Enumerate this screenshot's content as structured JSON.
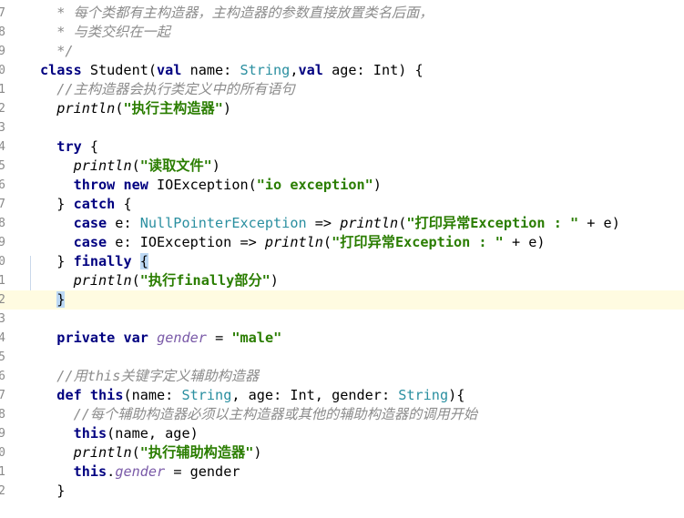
{
  "editor": {
    "lines": [
      {
        "num": "7",
        "segments": [
          {
            "t": "  * 每个类都有主构造器，主构造器的参数直接放置类名后面，",
            "c": "cm"
          }
        ]
      },
      {
        "num": "8",
        "segments": [
          {
            "t": "  * 与类交织在一起",
            "c": "cm"
          }
        ]
      },
      {
        "num": "9",
        "segments": [
          {
            "t": "  */",
            "c": "cm"
          }
        ]
      },
      {
        "num": "0",
        "segments": [
          {
            "t": "class",
            "c": "kw"
          },
          {
            "t": " Student(",
            "c": ""
          },
          {
            "t": "val",
            "c": "kw"
          },
          {
            "t": " name: ",
            "c": ""
          },
          {
            "t": "String",
            "c": "type"
          },
          {
            "t": ",",
            "c": ""
          },
          {
            "t": "val",
            "c": "kw"
          },
          {
            "t": " age: Int) {",
            "c": ""
          }
        ]
      },
      {
        "num": "1",
        "segments": [
          {
            "t": "  //主构造器会执行类定义中的所有语句",
            "c": "cm"
          }
        ]
      },
      {
        "num": "2",
        "segments": [
          {
            "t": "  ",
            "c": ""
          },
          {
            "t": "println",
            "c": "fn"
          },
          {
            "t": "(",
            "c": ""
          },
          {
            "t": "\"执行主构造器\"",
            "c": "str"
          },
          {
            "t": ")",
            "c": ""
          }
        ]
      },
      {
        "num": "3",
        "segments": []
      },
      {
        "num": "4",
        "segments": [
          {
            "t": "  ",
            "c": ""
          },
          {
            "t": "try",
            "c": "kw"
          },
          {
            "t": " {",
            "c": ""
          }
        ]
      },
      {
        "num": "5",
        "segments": [
          {
            "t": "    ",
            "c": ""
          },
          {
            "t": "println",
            "c": "fn"
          },
          {
            "t": "(",
            "c": ""
          },
          {
            "t": "\"读取文件\"",
            "c": "str"
          },
          {
            "t": ")",
            "c": ""
          }
        ]
      },
      {
        "num": "6",
        "segments": [
          {
            "t": "    ",
            "c": ""
          },
          {
            "t": "throw",
            "c": "kw"
          },
          {
            "t": " ",
            "c": ""
          },
          {
            "t": "new",
            "c": "kw"
          },
          {
            "t": " IOException(",
            "c": ""
          },
          {
            "t": "\"io exception\"",
            "c": "str"
          },
          {
            "t": ")",
            "c": ""
          }
        ]
      },
      {
        "num": "7",
        "segments": [
          {
            "t": "  } ",
            "c": ""
          },
          {
            "t": "catch",
            "c": "kw"
          },
          {
            "t": " {",
            "c": ""
          }
        ]
      },
      {
        "num": "8",
        "segments": [
          {
            "t": "    ",
            "c": ""
          },
          {
            "t": "case",
            "c": "kw"
          },
          {
            "t": " e: ",
            "c": ""
          },
          {
            "t": "NullPointerException",
            "c": "type"
          },
          {
            "t": " => ",
            "c": ""
          },
          {
            "t": "println",
            "c": "fn"
          },
          {
            "t": "(",
            "c": ""
          },
          {
            "t": "\"打印异常Exception : \"",
            "c": "str"
          },
          {
            "t": " + e)",
            "c": ""
          }
        ]
      },
      {
        "num": "9",
        "segments": [
          {
            "t": "    ",
            "c": ""
          },
          {
            "t": "case",
            "c": "kw"
          },
          {
            "t": " e: IOException => ",
            "c": ""
          },
          {
            "t": "println",
            "c": "fn"
          },
          {
            "t": "(",
            "c": ""
          },
          {
            "t": "\"打印异常Exception : \"",
            "c": "str"
          },
          {
            "t": " + e)",
            "c": ""
          }
        ]
      },
      {
        "num": "0",
        "segments": [
          {
            "t": "  } ",
            "c": ""
          },
          {
            "t": "finally",
            "c": "kw"
          },
          {
            "t": " ",
            "c": ""
          },
          {
            "t": "{",
            "c": "brace-hl"
          }
        ]
      },
      {
        "num": "1",
        "segments": [
          {
            "t": "    ",
            "c": ""
          },
          {
            "t": "println",
            "c": "fn"
          },
          {
            "t": "(",
            "c": ""
          },
          {
            "t": "\"执行finally部分\"",
            "c": "str"
          },
          {
            "t": ")",
            "c": ""
          }
        ]
      },
      {
        "num": "2",
        "current": true,
        "segments": [
          {
            "t": "  ",
            "c": ""
          },
          {
            "t": "}",
            "c": "brace-hl"
          }
        ]
      },
      {
        "num": "3",
        "segments": []
      },
      {
        "num": "4",
        "segments": [
          {
            "t": "  ",
            "c": ""
          },
          {
            "t": "private",
            "c": "kw"
          },
          {
            "t": " ",
            "c": ""
          },
          {
            "t": "var",
            "c": "kw"
          },
          {
            "t": " ",
            "c": ""
          },
          {
            "t": "gender",
            "c": "fld"
          },
          {
            "t": " = ",
            "c": ""
          },
          {
            "t": "\"male\"",
            "c": "str"
          }
        ]
      },
      {
        "num": "5",
        "segments": []
      },
      {
        "num": "6",
        "segments": [
          {
            "t": "  //用this关键字定义辅助构造器",
            "c": "cm"
          }
        ]
      },
      {
        "num": "7",
        "segments": [
          {
            "t": "  ",
            "c": ""
          },
          {
            "t": "def",
            "c": "kw"
          },
          {
            "t": " ",
            "c": ""
          },
          {
            "t": "this",
            "c": "kw"
          },
          {
            "t": "(name: ",
            "c": ""
          },
          {
            "t": "String",
            "c": "type"
          },
          {
            "t": ", age: Int, gender: ",
            "c": ""
          },
          {
            "t": "String",
            "c": "type"
          },
          {
            "t": "){",
            "c": ""
          }
        ]
      },
      {
        "num": "8",
        "segments": [
          {
            "t": "    //每个辅助构造器必须以主构造器或其他的辅助构造器的调用开始",
            "c": "cm"
          }
        ]
      },
      {
        "num": "9",
        "segments": [
          {
            "t": "    ",
            "c": ""
          },
          {
            "t": "this",
            "c": "kw"
          },
          {
            "t": "(name, age)",
            "c": ""
          }
        ]
      },
      {
        "num": "0",
        "segments": [
          {
            "t": "    ",
            "c": ""
          },
          {
            "t": "println",
            "c": "fn"
          },
          {
            "t": "(",
            "c": ""
          },
          {
            "t": "\"执行辅助构造器\"",
            "c": "str"
          },
          {
            "t": ")",
            "c": ""
          }
        ]
      },
      {
        "num": "1",
        "segments": [
          {
            "t": "    ",
            "c": ""
          },
          {
            "t": "this",
            "c": "kw"
          },
          {
            "t": ".",
            "c": ""
          },
          {
            "t": "gender",
            "c": "fld"
          },
          {
            "t": " = gender",
            "c": ""
          }
        ]
      },
      {
        "num": "2",
        "segments": [
          {
            "t": "  }",
            "c": ""
          }
        ]
      },
      {
        "num": "",
        "segments": []
      }
    ]
  }
}
